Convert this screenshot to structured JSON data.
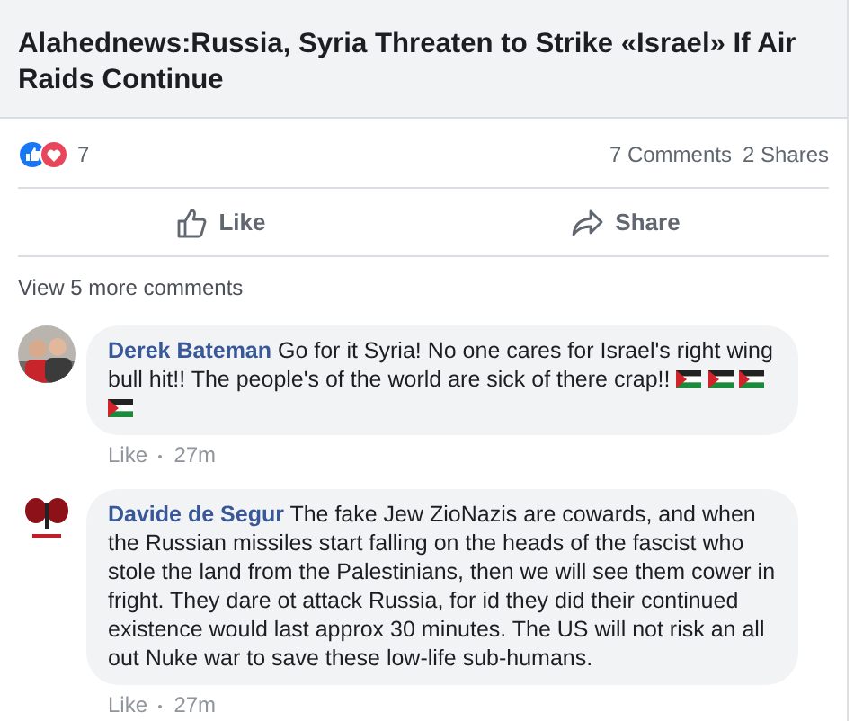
{
  "link_preview": {
    "title": "Alahednews:Russia, Syria Threaten to Strike «Israel» If Air Raids Continue"
  },
  "reactions": {
    "count": "7",
    "comments": "7 Comments",
    "shares": "2 Shares"
  },
  "actions": [
    {
      "kind": "like",
      "label": "Like"
    },
    {
      "kind": "share",
      "label": "Share"
    }
  ],
  "view_more": "View 5 more comments",
  "comments": [
    {
      "author": "Derek Bateman",
      "text": "Go for it Syria! No one cares for Israel's right wing bull hit!! The people's of the world are sick of there crap!!",
      "flags": [
        {
          "kind": "flag"
        },
        {
          "kind": "flag"
        },
        {
          "kind": "flag"
        },
        {
          "kind": "flag"
        }
      ],
      "like": "Like",
      "time": "27m"
    },
    {
      "author": "Davide de Segur",
      "text": "The fake Jew ZioNazis are cowards, and when the Russian missiles start falling on the heads of the fascist who stole the land from the Palestinians, then we will see them cower in fright. They dare ot attack Russia, for id they did their continued existence would last approx 30 minutes. The US will not risk an all out Nuke war to save these low-life sub-humans.",
      "like": "Like",
      "time": "27m"
    }
  ]
}
